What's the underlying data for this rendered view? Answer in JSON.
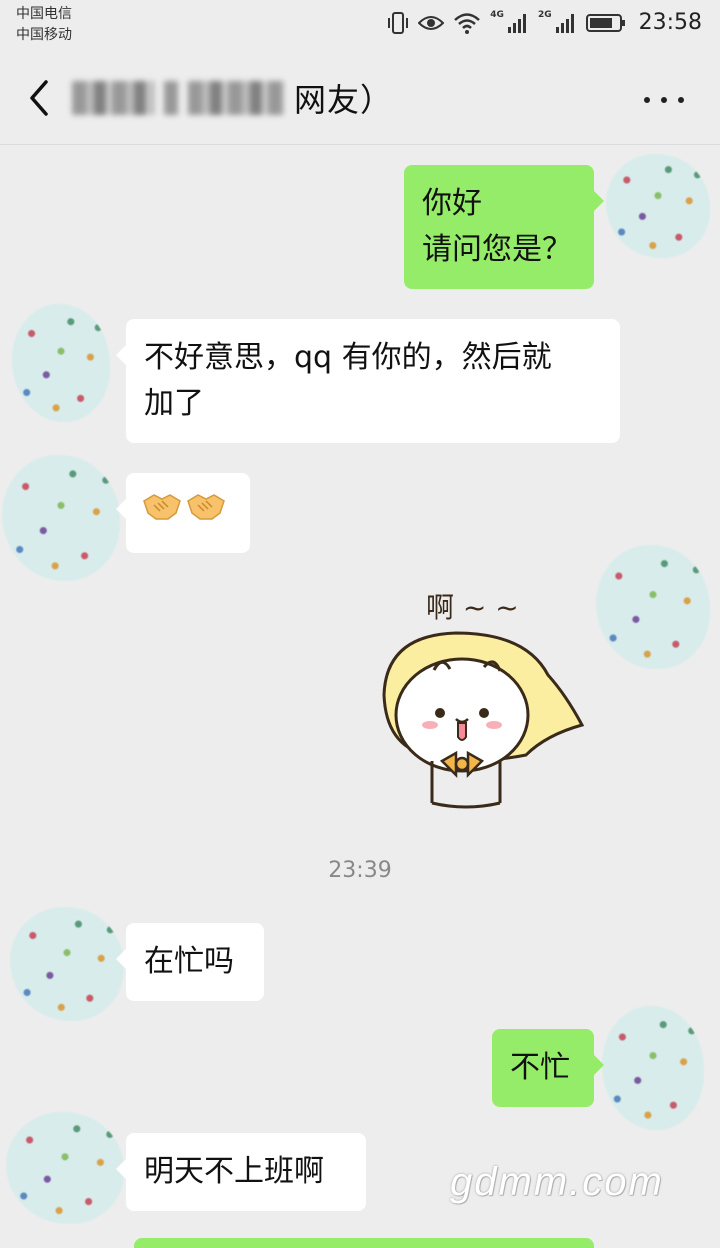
{
  "status_bar": {
    "carrier1": "中国电信",
    "carrier2": "中国移动",
    "net1": "4G",
    "net2": "2G",
    "time": "23:58"
  },
  "nav": {
    "title_visible": "网友）",
    "back_icon": "chevron-left-icon",
    "more_icon": "more-dots-icon"
  },
  "messages": [
    {
      "side": "out",
      "lines": [
        "你好",
        "请问您是？"
      ]
    },
    {
      "side": "in",
      "lines": [
        "不好意思，qq 有你的，然后就",
        "加了"
      ]
    },
    {
      "side": "in",
      "emoji": "handshake-icon",
      "count": 2
    },
    {
      "side": "out",
      "sticker": "cat-sticker",
      "sticker_text": "啊 ~ ~"
    },
    {
      "side": "in",
      "lines": [
        "在忙吗"
      ]
    },
    {
      "side": "out",
      "lines": [
        "不忙"
      ]
    },
    {
      "side": "in",
      "lines": [
        "明天不上班啊"
      ]
    }
  ],
  "timestamp": "23:39",
  "watermark": "gdmm.com",
  "colors": {
    "background": "#ededed",
    "outgoing_bubble": "#95ec69",
    "incoming_bubble": "#ffffff"
  }
}
